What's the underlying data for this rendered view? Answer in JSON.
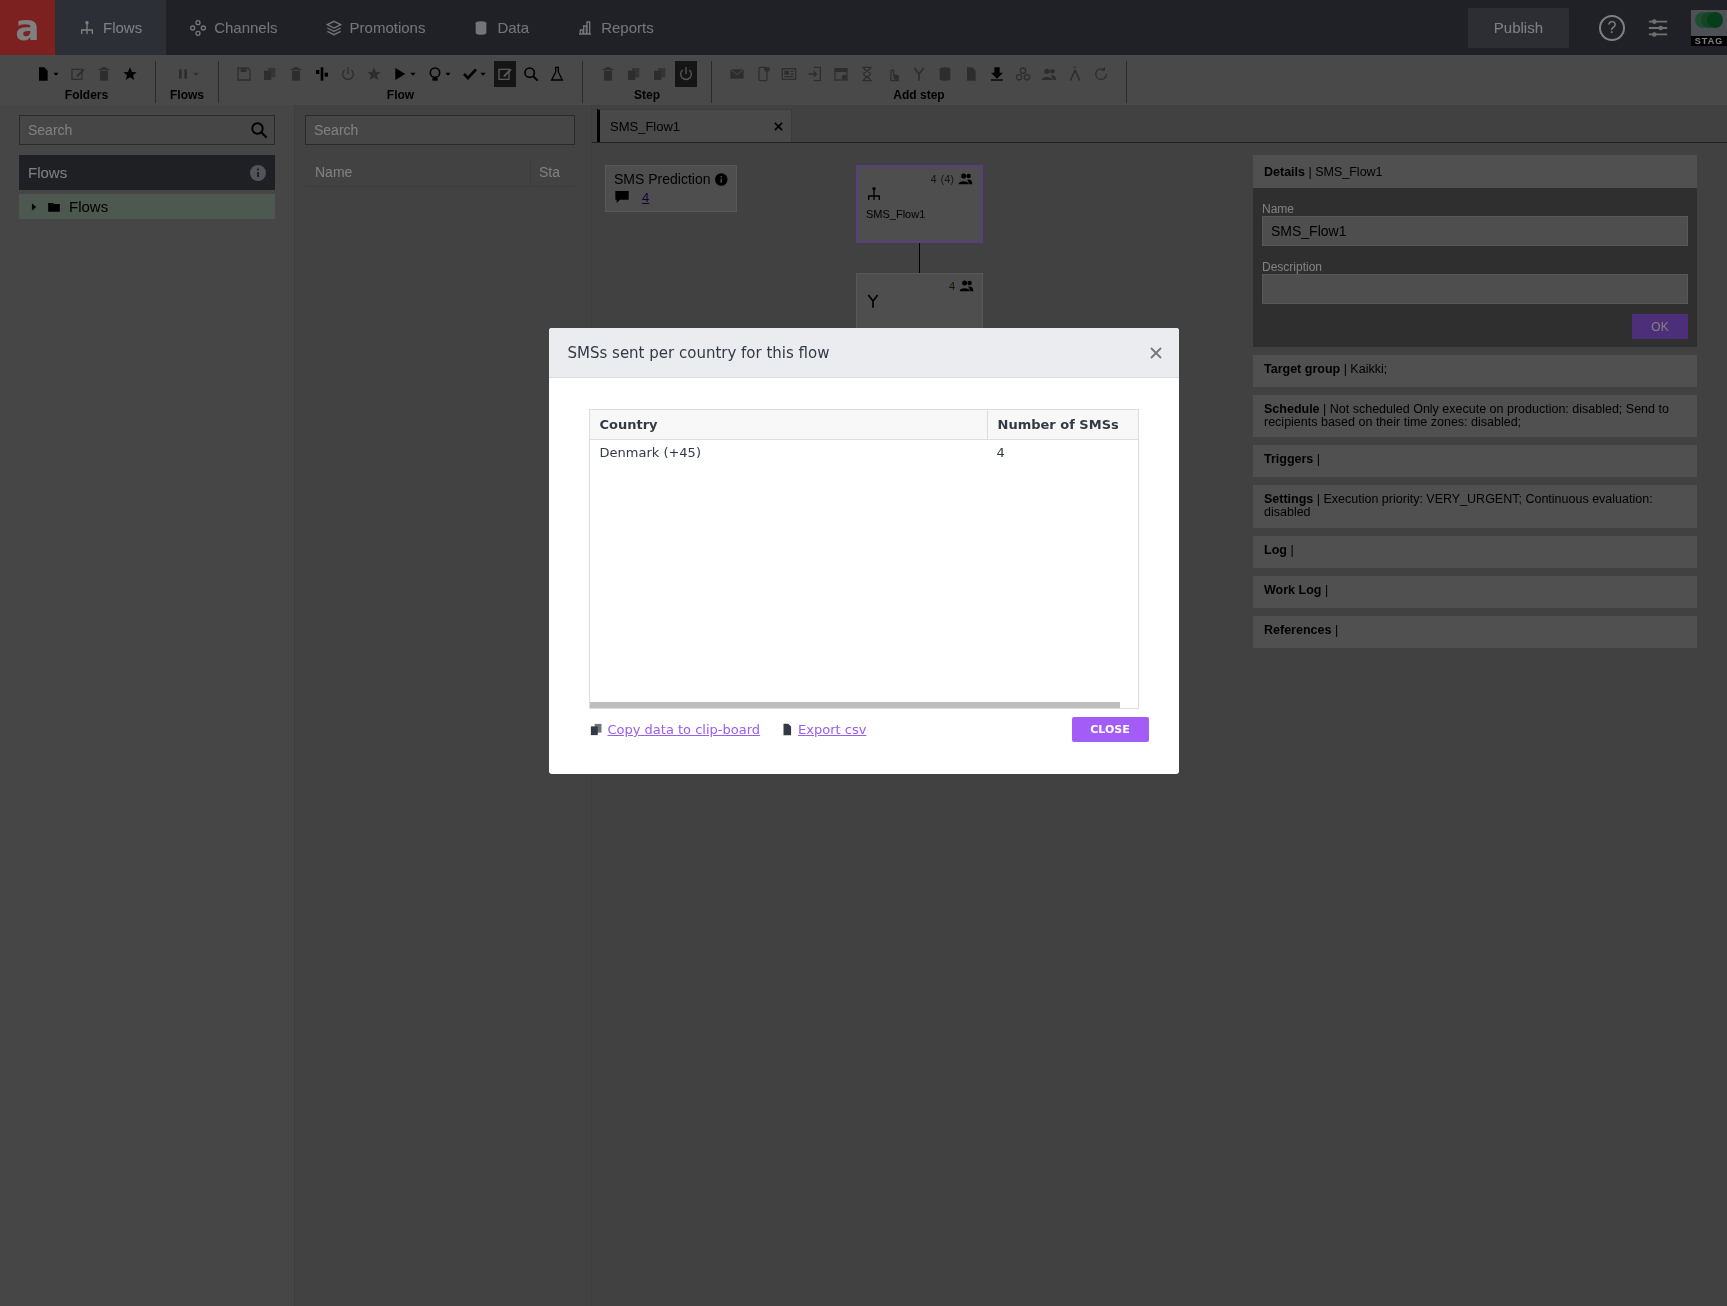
{
  "nav": {
    "logo": "a",
    "tabs": [
      {
        "label": "Flows",
        "selected": true
      },
      {
        "label": "Channels",
        "selected": false
      },
      {
        "label": "Promotions",
        "selected": false
      },
      {
        "label": "Data",
        "selected": false
      },
      {
        "label": "Reports",
        "selected": false
      }
    ],
    "publish": "Publish",
    "help": "?",
    "environment": "STAG"
  },
  "toolbar": {
    "groups": [
      {
        "label": "Folders",
        "buttons": [
          {
            "kind": "file",
            "dropdown": true,
            "disabled": false,
            "active": false
          },
          {
            "kind": "edit",
            "dropdown": false,
            "disabled": true,
            "active": false
          },
          {
            "kind": "trash",
            "dropdown": false,
            "disabled": true,
            "active": false
          },
          {
            "kind": "star",
            "dropdown": false,
            "disabled": false,
            "active": false
          }
        ]
      },
      {
        "label": "Flows",
        "buttons": [
          {
            "kind": "pause",
            "dropdown": true,
            "disabled": true,
            "active": false
          }
        ]
      },
      {
        "label": "Flow",
        "buttons": [
          {
            "kind": "save",
            "dropdown": false,
            "disabled": true,
            "active": false
          },
          {
            "kind": "copy",
            "dropdown": false,
            "disabled": true,
            "active": false
          },
          {
            "kind": "trash",
            "dropdown": false,
            "disabled": true,
            "active": false
          },
          {
            "kind": "split",
            "dropdown": false,
            "disabled": false,
            "active": false
          },
          {
            "kind": "power",
            "dropdown": false,
            "disabled": true,
            "active": false
          },
          {
            "kind": "star",
            "dropdown": false,
            "disabled": true,
            "active": false
          },
          {
            "kind": "play",
            "dropdown": true,
            "disabled": false,
            "active": false
          },
          {
            "kind": "bulb",
            "dropdown": true,
            "disabled": false,
            "active": false
          },
          {
            "kind": "check",
            "dropdown": true,
            "disabled": false,
            "active": false
          },
          {
            "kind": "edit",
            "dropdown": false,
            "disabled": false,
            "active": true
          },
          {
            "kind": "search",
            "dropdown": false,
            "disabled": false,
            "active": false
          },
          {
            "kind": "flask",
            "dropdown": false,
            "disabled": false,
            "active": false
          }
        ]
      },
      {
        "label": "Step",
        "buttons": [
          {
            "kind": "trash",
            "dropdown": false,
            "disabled": true,
            "active": false
          },
          {
            "kind": "copy",
            "dropdown": false,
            "disabled": true,
            "active": false
          },
          {
            "kind": "copy",
            "dropdown": false,
            "disabled": true,
            "active": false
          },
          {
            "kind": "power",
            "dropdown": false,
            "disabled": false,
            "active": true
          }
        ]
      },
      {
        "label": "Add step",
        "buttons": [
          {
            "kind": "mail",
            "dropdown": false,
            "disabled": true,
            "active": false
          },
          {
            "kind": "phone",
            "dropdown": false,
            "disabled": true,
            "active": false
          },
          {
            "kind": "newspaper",
            "dropdown": false,
            "disabled": true,
            "active": false
          },
          {
            "kind": "login",
            "dropdown": false,
            "disabled": true,
            "active": false
          },
          {
            "kind": "calendar",
            "dropdown": false,
            "disabled": true,
            "active": false
          },
          {
            "kind": "hourglass",
            "dropdown": false,
            "disabled": true,
            "active": false
          },
          {
            "kind": "touch",
            "dropdown": false,
            "disabled": true,
            "active": false
          },
          {
            "kind": "fork",
            "dropdown": false,
            "disabled": true,
            "active": false
          },
          {
            "kind": "database",
            "dropdown": false,
            "disabled": true,
            "active": false
          },
          {
            "kind": "file",
            "dropdown": false,
            "disabled": true,
            "active": false
          },
          {
            "kind": "download",
            "dropdown": false,
            "disabled": false,
            "active": false
          },
          {
            "kind": "cluster",
            "dropdown": false,
            "disabled": true,
            "active": false
          },
          {
            "kind": "users",
            "dropdown": false,
            "disabled": true,
            "active": false
          },
          {
            "kind": "lambda",
            "dropdown": false,
            "disabled": true,
            "active": false
          },
          {
            "kind": "refresh",
            "dropdown": false,
            "disabled": true,
            "active": false
          }
        ]
      }
    ]
  },
  "folders": {
    "search": {
      "placeholder": "Search"
    },
    "title": "Flows",
    "tree": [
      {
        "label": "Flows",
        "expanded": false,
        "selected": true
      }
    ]
  },
  "list": {
    "search": {
      "placeholder": "Search"
    },
    "columns": [
      "Name",
      "Sta"
    ]
  },
  "editor": {
    "tab": {
      "label": "SMS_Flow1",
      "selected": true
    },
    "prediction": {
      "title": "SMS Prediction",
      "count": "4"
    },
    "nodes": [
      {
        "kind": "start",
        "count": "4",
        "total": "(4)",
        "label": "SMS_Flow1",
        "selected": true
      },
      {
        "kind": "split",
        "count": "4",
        "selected": false
      }
    ]
  },
  "details": {
    "title": "**Details** | SMS_Flow1",
    "name_label": "Name",
    "name": "SMS_Flow1",
    "description_label": "Description",
    "ok": "OK",
    "sections": [
      "**Target group** | Kaikki;",
      "**Schedule** | Not scheduled Only execute on production: disabled; Send to recipients based on their time zones: disabled;",
      "**Triggers** |",
      "**Settings** | Execution priority: VERY_URGENT; Continuous evaluation: disabled",
      "**Log** |",
      "**Work Log** |",
      "**References** |"
    ]
  },
  "modal": {
    "title": "SMSs sent per country for this flow",
    "columns": [
      "Country",
      "Number of SMSs"
    ],
    "rows": [
      [
        "Denmark (+45)",
        "4"
      ]
    ],
    "copy_link": "Copy data to clip-board",
    "export_link": "Export csv",
    "close": "CLOSE"
  }
}
